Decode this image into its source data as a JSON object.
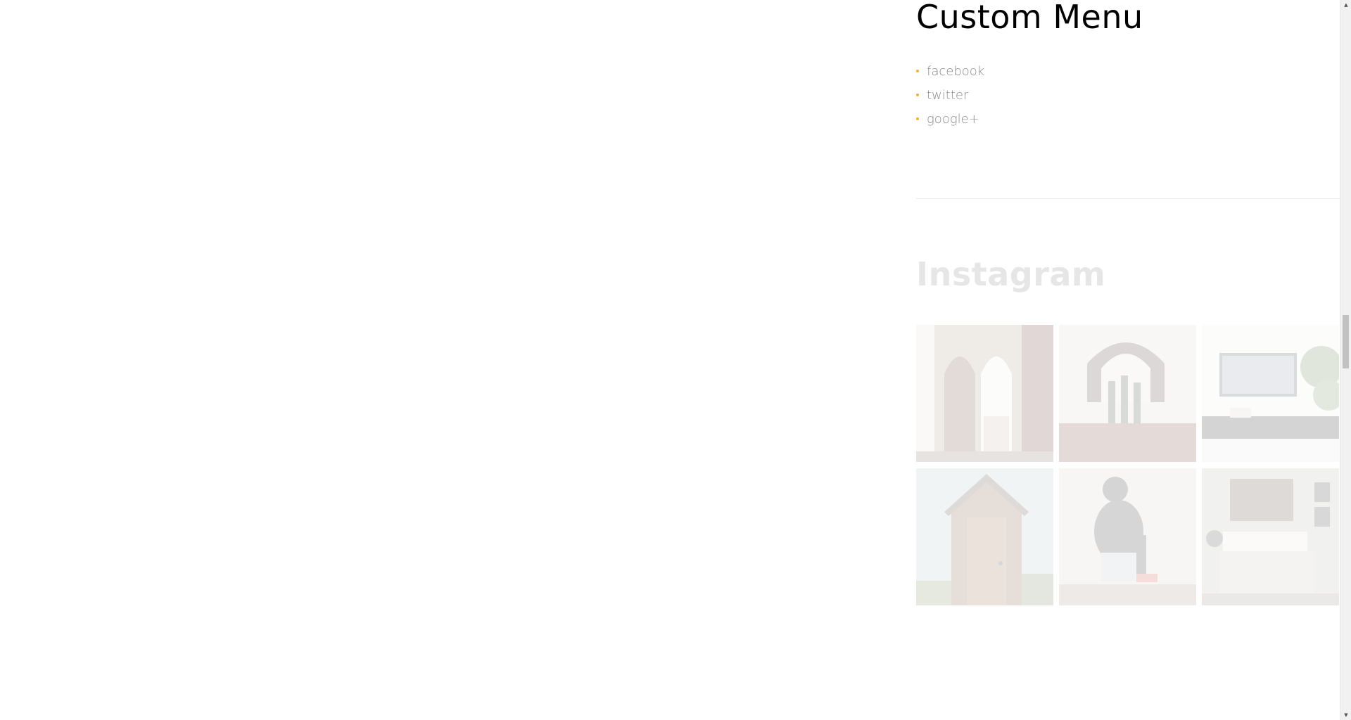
{
  "custom_menu": {
    "title": "Custom Menu",
    "items": [
      {
        "label": "facebook"
      },
      {
        "label": "twitter"
      },
      {
        "label": "google+"
      }
    ],
    "bullet_color": "#f0b429"
  },
  "instagram": {
    "title": "Instagram",
    "tiles": [
      {
        "subject": "gothic-arched-door"
      },
      {
        "subject": "arched-mirror-with-bottles"
      },
      {
        "subject": "tv-on-console-with-plant"
      },
      {
        "subject": "wooden-shed-door"
      },
      {
        "subject": "person-crouching-on-gravel"
      },
      {
        "subject": "bedroom-with-framed-art"
      }
    ]
  },
  "scrollbar": {
    "up_icon": "▲",
    "down_icon": "▼"
  }
}
